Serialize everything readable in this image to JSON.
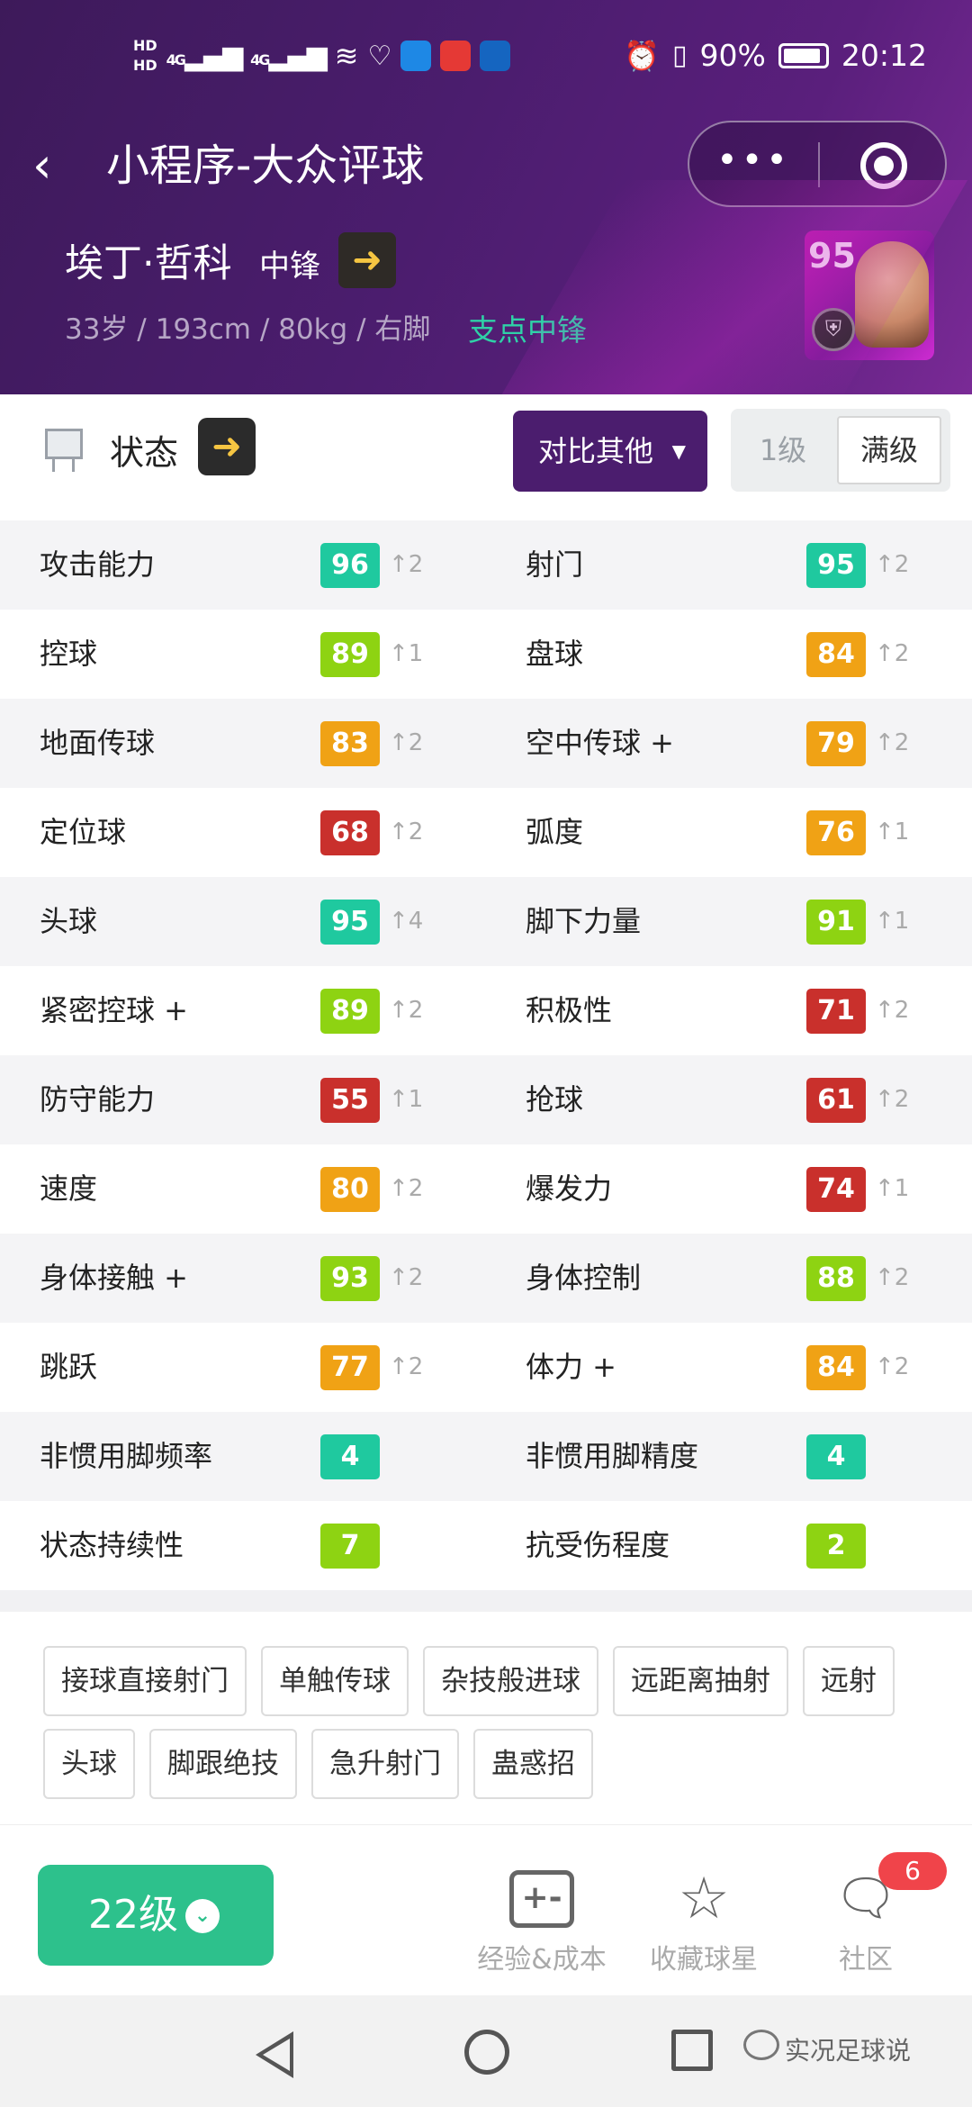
{
  "status_bar": {
    "network_label_1": "HD",
    "network_label_2": "HD",
    "signal_1": "4G",
    "signal_2": "4G",
    "battery_percent": "90%",
    "time": "20:12"
  },
  "navbar": {
    "title": "小程序-大众评球",
    "back_icon": "chevron-left-icon",
    "more_label": "•••"
  },
  "player": {
    "name": "埃丁·哲科",
    "position": "中锋",
    "info": "33岁 / 193cm / 80kg / 右脚",
    "role": "支点中锋",
    "rating": "95"
  },
  "controls": {
    "state_label": "状态",
    "compare_label": "对比其他",
    "level_1": "1级",
    "level_max": "满级"
  },
  "colors": {
    "green": "#1fc99f",
    "lime": "#8ed312",
    "orange": "#f0a215",
    "red": "#c9302c",
    "header": "#4b1d6e",
    "accent_green": "#2dc18c"
  },
  "stats": [
    {
      "left": {
        "name": "攻击能力",
        "value": "96",
        "delta": "↑2",
        "color": "#1fc99f"
      },
      "right": {
        "name": "射门",
        "value": "95",
        "delta": "↑2",
        "color": "#1fc99f"
      }
    },
    {
      "left": {
        "name": "控球",
        "value": "89",
        "delta": "↑1",
        "color": "#8ed312"
      },
      "right": {
        "name": "盘球",
        "value": "84",
        "delta": "↑2",
        "color": "#f0a215"
      }
    },
    {
      "left": {
        "name": "地面传球",
        "value": "83",
        "delta": "↑2",
        "color": "#f0a215"
      },
      "right": {
        "name": "空中传球 +",
        "value": "79",
        "delta": "↑2",
        "color": "#f0a215"
      }
    },
    {
      "left": {
        "name": "定位球",
        "value": "68",
        "delta": "↑2",
        "color": "#c9302c"
      },
      "right": {
        "name": "弧度",
        "value": "76",
        "delta": "↑1",
        "color": "#f0a215"
      }
    },
    {
      "left": {
        "name": "头球",
        "value": "95",
        "delta": "↑4",
        "color": "#1fc99f"
      },
      "right": {
        "name": "脚下力量",
        "value": "91",
        "delta": "↑1",
        "color": "#8ed312"
      }
    },
    {
      "left": {
        "name": "紧密控球 +",
        "value": "89",
        "delta": "↑2",
        "color": "#8ed312"
      },
      "right": {
        "name": "积极性",
        "value": "71",
        "delta": "↑2",
        "color": "#c9302c"
      }
    },
    {
      "left": {
        "name": "防守能力",
        "value": "55",
        "delta": "↑1",
        "color": "#c9302c"
      },
      "right": {
        "name": "抢球",
        "value": "61",
        "delta": "↑2",
        "color": "#c9302c"
      }
    },
    {
      "left": {
        "name": "速度",
        "value": "80",
        "delta": "↑2",
        "color": "#f0a215"
      },
      "right": {
        "name": "爆发力",
        "value": "74",
        "delta": "↑1",
        "color": "#c9302c"
      }
    },
    {
      "left": {
        "name": "身体接触 +",
        "value": "93",
        "delta": "↑2",
        "color": "#8ed312"
      },
      "right": {
        "name": "身体控制",
        "value": "88",
        "delta": "↑2",
        "color": "#8ed312"
      }
    },
    {
      "left": {
        "name": "跳跃",
        "value": "77",
        "delta": "↑2",
        "color": "#f0a215"
      },
      "right": {
        "name": "体力 +",
        "value": "84",
        "delta": "↑2",
        "color": "#f0a215"
      }
    },
    {
      "left": {
        "name": "非惯用脚频率",
        "value": "4",
        "delta": "",
        "color": "#1fc99f"
      },
      "right": {
        "name": "非惯用脚精度",
        "value": "4",
        "delta": "",
        "color": "#1fc99f"
      }
    },
    {
      "left": {
        "name": "状态持续性",
        "value": "7",
        "delta": "",
        "color": "#8ed312"
      },
      "right": {
        "name": "抗受伤程度",
        "value": "2",
        "delta": "",
        "color": "#8ed312"
      }
    }
  ],
  "skills": [
    "接球直接射门",
    "单触传球",
    "杂技般进球",
    "远距离抽射",
    "远射",
    "头球",
    "脚跟绝技",
    "急升射门",
    "蛊惑招"
  ],
  "bottom": {
    "level_label": "22级",
    "tab_exp": "经验&成本",
    "tab_fav": "收藏球星",
    "tab_community": "社区",
    "community_badge": "6"
  },
  "watermark": "实况足球说"
}
